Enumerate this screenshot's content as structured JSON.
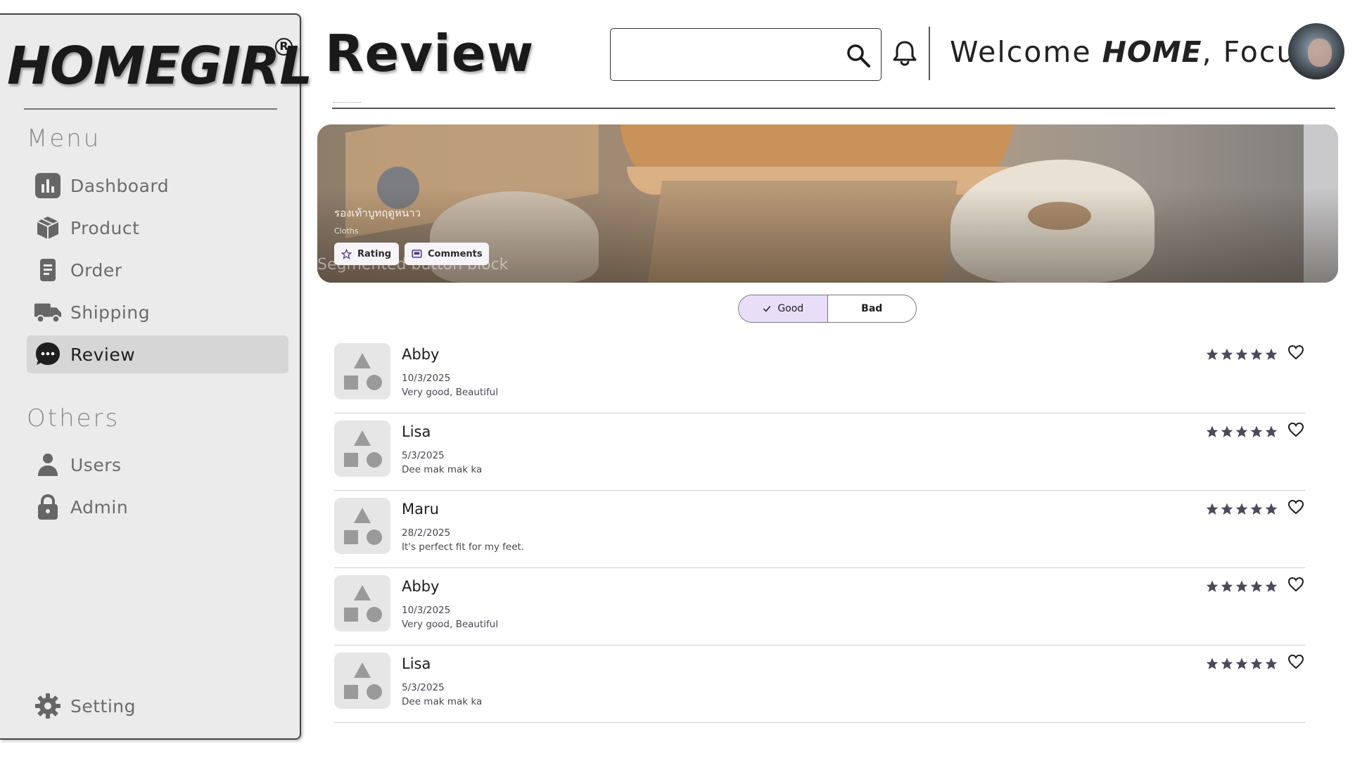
{
  "sidebar": {
    "logo": "HOMEGIRL",
    "logo_mark": "R",
    "menu_title": "Menu",
    "menu_items": [
      {
        "label": "Dashboard",
        "icon": "bar-chart-icon"
      },
      {
        "label": "Product",
        "icon": "box-icon"
      },
      {
        "label": "Order",
        "icon": "document-icon"
      },
      {
        "label": "Shipping",
        "icon": "truck-icon"
      },
      {
        "label": "Review",
        "icon": "chat-bubble-icon",
        "active": true
      }
    ],
    "others_title": "Others",
    "others_items": [
      {
        "label": "Users",
        "icon": "person-icon"
      },
      {
        "label": "Admin",
        "icon": "lock-icon"
      }
    ],
    "setting_label": "Setting"
  },
  "header": {
    "title": "Review",
    "search": {
      "value": "",
      "placeholder": ""
    },
    "welcome_prefix": "Welcome ",
    "welcome_brand": "HOME",
    "welcome_suffix": ", Focus"
  },
  "banner": {
    "title": "รองเท้าบูทฤดูหนาว",
    "subtitle": "Cloths",
    "rating_label": "Rating",
    "comments_label": "Comments",
    "caption": "Segmented button block"
  },
  "segmented": {
    "good_label": "Good",
    "bad_label": "Bad",
    "selected": "Good"
  },
  "reviews": [
    {
      "name": "Abby",
      "date": "10/3/2025",
      "text": "Very good, Beautiful",
      "rating": 5
    },
    {
      "name": "Lisa",
      "date": "5/3/2025",
      "text": "Dee mak mak ka",
      "rating": 5
    },
    {
      "name": "Maru",
      "date": "28/2/2025",
      "text": "It's perfect fit for my feet.",
      "rating": 5
    },
    {
      "name": "Abby",
      "date": "10/3/2025",
      "text": "Very good, Beautiful",
      "rating": 5
    },
    {
      "name": "Lisa",
      "date": "5/3/2025",
      "text": "Dee mak mak ka",
      "rating": 5
    }
  ],
  "colors": {
    "sidebar_bg": "#ebebeb",
    "active_item_bg": "#d6d6d6",
    "segment_selected_bg": "#e8def8",
    "star": "#4a4a5a"
  }
}
